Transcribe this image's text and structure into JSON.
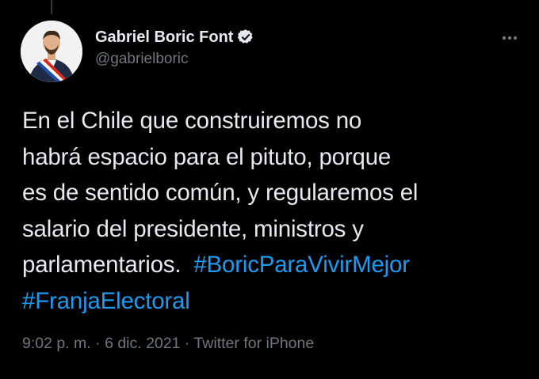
{
  "author": {
    "display_name": "Gabriel Boric Font",
    "handle": "@gabrielboric",
    "verified": true,
    "avatar_icon": "profile-photo"
  },
  "tweet": {
    "lines": [
      "En el Chile que construiremos no",
      "habrá espacio para el pituto, porque",
      "es de sentido común, y regularemos el",
      "salario del presidente, ministros y",
      "parlamentarios."
    ],
    "hashtags": [
      "#BoricParaVivirMejor",
      "#FranjaElectoral"
    ]
  },
  "meta": {
    "time": "9:02 p. m.",
    "separator": "·",
    "date": "6 dic. 2021",
    "source": "Twitter for iPhone"
  },
  "colors": {
    "background": "#000000",
    "text": "#e7e9ea",
    "secondary": "#71767b",
    "link": "#1d9bf0"
  },
  "icons": {
    "more": "more-horizontal-icon",
    "verified": "verified-badge-icon"
  }
}
